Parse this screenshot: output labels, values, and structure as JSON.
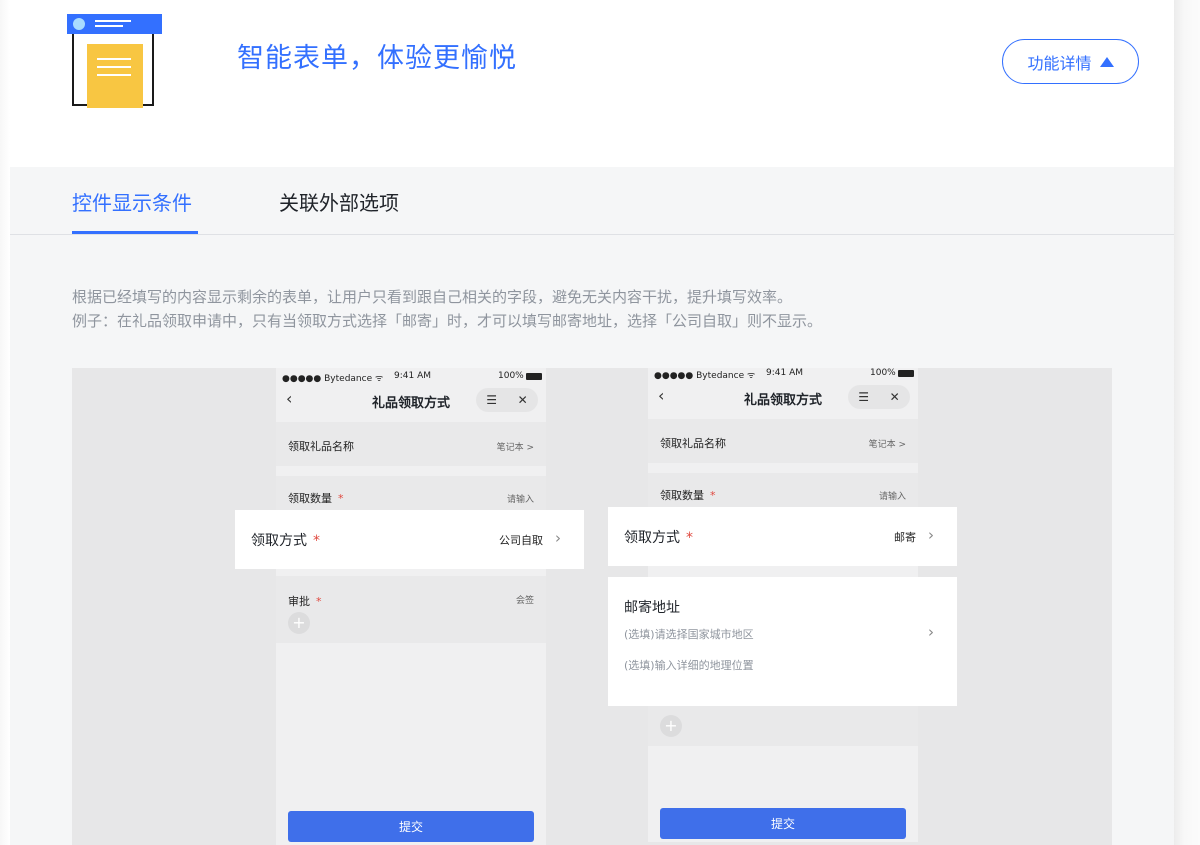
{
  "header": {
    "headline": "智能表单，体验更愉悦",
    "detail_button": "功能详情"
  },
  "tabs": [
    {
      "label": "控件显示条件",
      "active": true
    },
    {
      "label": "关联外部选项",
      "active": false
    }
  ],
  "description": {
    "line1": "根据已经填写的内容显示剩余的表单，让用户只看到跟自己相关的字段，避免无关内容干扰，提升填写效率。",
    "line2": "例子：在礼品领取申请中，只有当领取方式选择「邮寄」时，才可以填写邮寄地址，选择「公司自取」则不显示。"
  },
  "colors": {
    "accent": "#3370ff",
    "submit": "#3f6fea",
    "required": "#e0483e",
    "logo_doc": "#f8c642"
  },
  "phones": [
    {
      "status": {
        "carrier": "●●●●● Bytedance ᯤ",
        "time": "9:41 AM",
        "battery": "100%"
      },
      "title": "礼品领取方式",
      "gift_name": {
        "label": "领取礼品名称",
        "value": "笔记本 >"
      },
      "quantity": {
        "label": "领取数量",
        "value": "请输入"
      },
      "method": {
        "label": "领取方式",
        "value": "公司自取"
      },
      "approval": {
        "label": "审批",
        "value": "会签"
      },
      "submit": "提交"
    },
    {
      "status": {
        "carrier": "●●●●● Bytedance ᯤ",
        "time": "9:41 AM",
        "battery": "100%"
      },
      "title": "礼品领取方式",
      "gift_name": {
        "label": "领取礼品名称",
        "value": "笔记本 >"
      },
      "quantity": {
        "label": "领取数量",
        "value": "请输入"
      },
      "method": {
        "label": "领取方式",
        "value": "邮寄"
      },
      "address": {
        "label": "邮寄地址",
        "region_hint": "(选填)请选择国家城市地区",
        "detail_hint": "(选填)输入详细的地理位置"
      },
      "submit": "提交"
    }
  ],
  "icons": {
    "logo": "form-document-icon",
    "triangle": "triangle-up-icon",
    "back": "chevron-left-icon",
    "menu": "menu-icon",
    "close": "close-icon",
    "add": "plus-icon",
    "chevron": "chevron-right-icon"
  }
}
